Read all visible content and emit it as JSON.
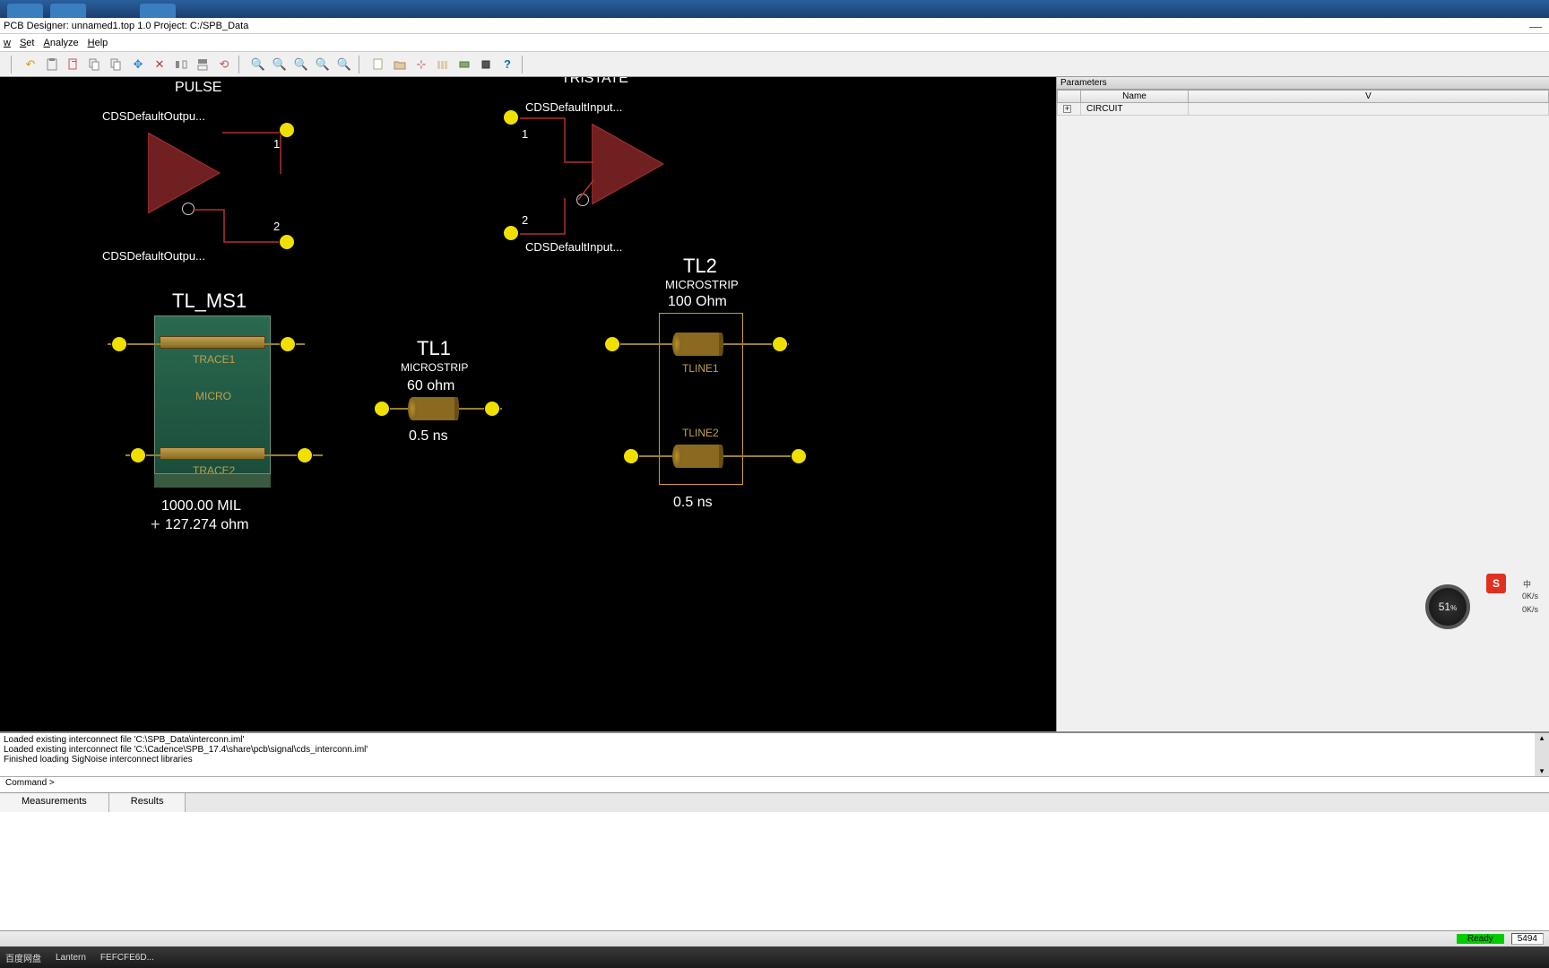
{
  "title": "PCB Designer: unnamed1.top 1.0  Project: C:/SPB_Data",
  "menu": {
    "items": [
      "w",
      "Set",
      "Analyze",
      "Help"
    ]
  },
  "schematic": {
    "pulse": {
      "title": "PULSE",
      "top_label": "CDSDefaultOutpu...",
      "bottom_label": "CDSDefaultOutpu...",
      "pin1": "1",
      "pin2": "2"
    },
    "tristate": {
      "title": "TRISTATE",
      "top_label": "CDSDefaultInput...",
      "bottom_label": "CDSDefaultInput...",
      "pin1": "1",
      "pin2": "2"
    },
    "tl_ms1": {
      "name": "TL_MS1",
      "trace1": "TRACE1",
      "trace2": "TRACE2",
      "inner": "MICRO",
      "length": "1000.00 MIL",
      "impedance": "127.274 ohm"
    },
    "tl1": {
      "name": "TL1",
      "type": "MICROSTRIP",
      "impedance": "60 ohm",
      "delay": "0.5 ns"
    },
    "tl2": {
      "name": "TL2",
      "type": "MICROSTRIP",
      "impedance": "100 Ohm",
      "tline1": "TLINE1",
      "tline2": "TLINE2",
      "delay": "0.5 ns"
    }
  },
  "parameters": {
    "header": "Parameters",
    "col_name": "Name",
    "col_value": "V",
    "row1": "CIRCUIT"
  },
  "log": {
    "l1": "Loaded existing interconnect file 'C:\\SPB_Data\\interconn.iml'",
    "l2": "Loaded existing interconnect file 'C:\\Cadence\\SPB_17.4\\share\\pcb\\signal\\cds_interconn.iml'",
    "l3": "Finished loading SigNoise interconnect libraries"
  },
  "cmd": "Command >",
  "tabs": {
    "measurements": "Measurements",
    "results": "Results"
  },
  "status": {
    "ready": "Ready",
    "coord": "5494"
  },
  "gauge": {
    "value": "51",
    "unit": "%",
    "rate": "0K/s"
  },
  "ime_lang": "中",
  "taskbar": {
    "i1": "百度网盘",
    "i2": "Lantern",
    "i3": "FEFCFE6D..."
  }
}
